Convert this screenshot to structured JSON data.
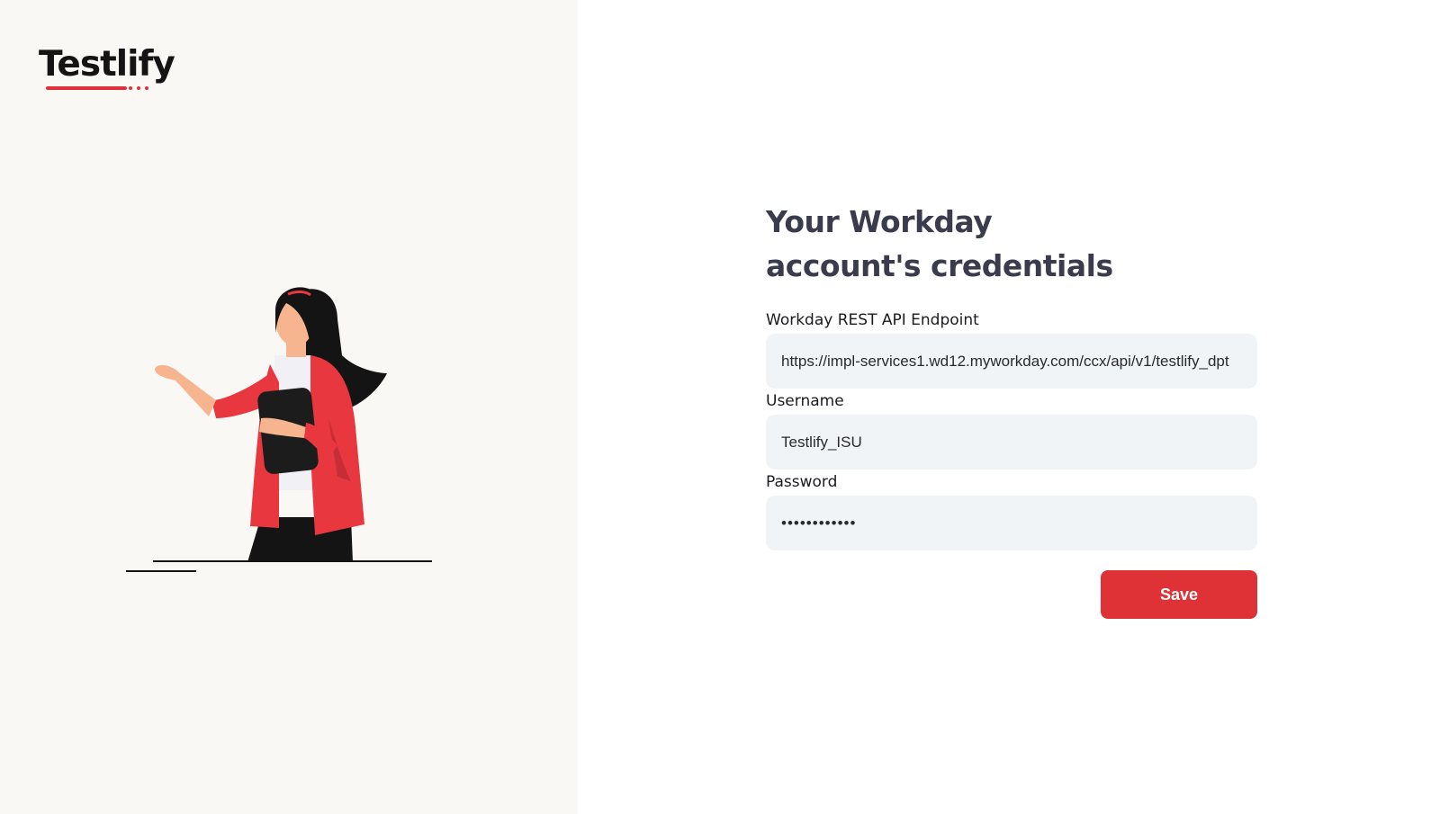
{
  "brand": {
    "logo_text": "Testlify",
    "accent_color": "#e0313a"
  },
  "form": {
    "title": "Your Workday account's credentials",
    "fields": {
      "endpoint": {
        "label": "Workday REST API Endpoint",
        "value": "https://impl-services1.wd12.myworkday.com/ccx/api/v1/testlify_dpt"
      },
      "username": {
        "label": "Username",
        "value": "Testlify_ISU"
      },
      "password": {
        "label": "Password",
        "value": "••••••••••••"
      }
    },
    "save_label": "Save",
    "save_color": "#de3237"
  },
  "illustration": {
    "icon": "woman-holding-tablet-illustration"
  }
}
